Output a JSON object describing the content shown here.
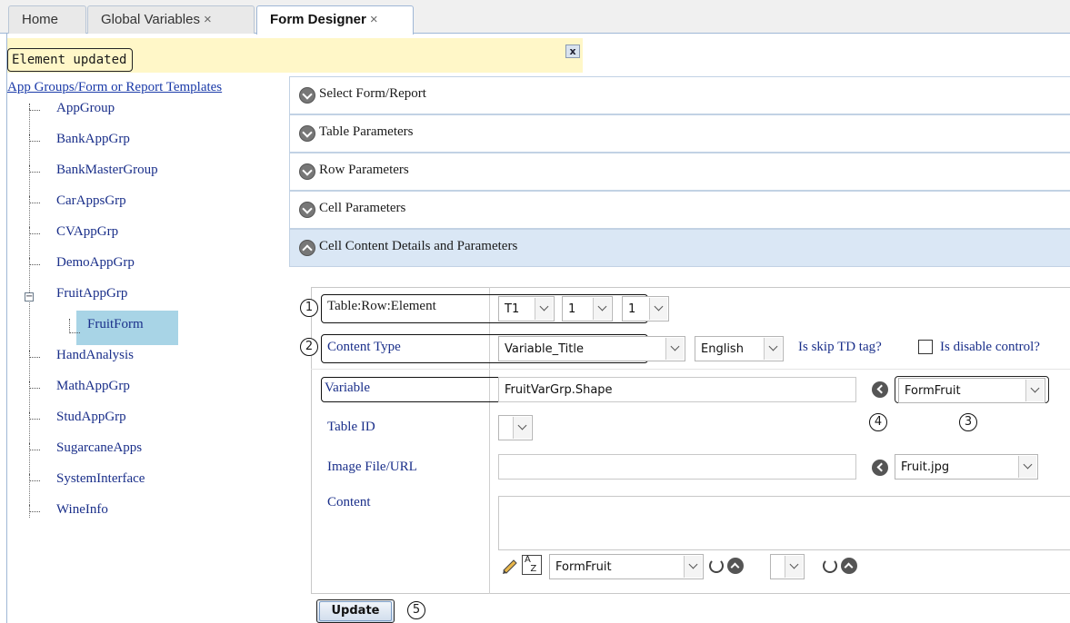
{
  "tabs": [
    {
      "label": "Home"
    },
    {
      "label": "Global Variables",
      "close": "×"
    },
    {
      "label": "Form Designer",
      "close": "×",
      "active": true
    }
  ],
  "status": {
    "message": "Element updated",
    "close": "x"
  },
  "tree": {
    "title": "App Groups/Form or Report Templates",
    "items": [
      "AppGroup",
      "BankAppGrp",
      "BankMasterGroup",
      "CarAppsGrp",
      "CVAppGrp",
      "DemoAppGrp",
      "FruitAppGrp"
    ],
    "child": "FruitForm",
    "items_after": [
      "HandAnalysis",
      "MathAppGrp",
      "StudAppGrp",
      "SugarcaneApps",
      "SystemInterface",
      "WineInfo"
    ],
    "expander": "−"
  },
  "accordion": [
    {
      "label": "Select Form/Report"
    },
    {
      "label": "Table Parameters"
    },
    {
      "label": "Row Parameters"
    },
    {
      "label": "Cell Parameters"
    },
    {
      "label": "Cell Content Details and Parameters"
    }
  ],
  "form": {
    "table_row_element": {
      "label": "Table:Row:Element",
      "table": "T1",
      "row": "1",
      "element": "1"
    },
    "content_type": {
      "label": "Content Type",
      "value": "Variable_Title",
      "language": "English"
    },
    "skip_td": {
      "label": "Is skip TD tag?"
    },
    "disable_control": {
      "label": "Is disable control?"
    },
    "variable": {
      "label": "Variable",
      "value": "FruitVarGrp.Shape",
      "form": "FormFruit"
    },
    "table_id": {
      "label": "Table ID",
      "value": ""
    },
    "image": {
      "label": "Image File/URL",
      "value": "",
      "file": "Fruit.jpg"
    },
    "content": {
      "label": "Content",
      "form": "FormFruit",
      "second": ""
    },
    "update": "Update"
  },
  "callouts": [
    "1",
    "2",
    "3",
    "4",
    "5"
  ],
  "colors": {
    "accent": "#dae7f5",
    "tree_selected": "#a8d4e6",
    "status_bg": "#fff7c8",
    "link": "#1a2f8a"
  }
}
